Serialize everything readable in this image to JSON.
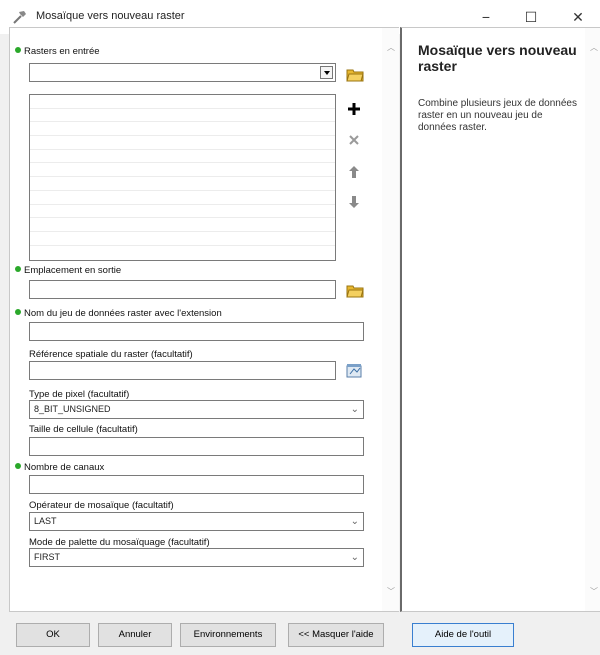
{
  "window": {
    "title": "Mosaïque vers nouveau raster",
    "minimize": "−",
    "maximize": "☐",
    "close": "✕"
  },
  "params": {
    "input_rasters": {
      "label": "Rasters en entrée",
      "value": ""
    },
    "output_location": {
      "label": "Emplacement en sortie",
      "value": ""
    },
    "dataset_name": {
      "label": "Nom du jeu de données raster avec l'extension",
      "value": ""
    },
    "spatial_reference": {
      "label": "Référence spatiale du raster (facultatif)",
      "value": ""
    },
    "pixel_type": {
      "label": "Type de pixel (facultatif)",
      "value": "8_BIT_UNSIGNED"
    },
    "cell_size": {
      "label": "Taille de cellule (facultatif)",
      "value": ""
    },
    "band_count": {
      "label": "Nombre de canaux",
      "value": ""
    },
    "mosaic_operator": {
      "label": "Opérateur de mosaïque (facultatif)",
      "value": "LAST"
    },
    "colormap_mode": {
      "label": "Mode de palette du mosaïquage (facultatif)",
      "value": "FIRST"
    }
  },
  "help": {
    "title": "Mosaïque vers nouveau raster",
    "text": "Combine plusieurs jeux de données raster en un nouveau jeu de données raster."
  },
  "buttons": {
    "ok": "OK",
    "cancel": "Annuler",
    "environments": "Environnements",
    "hide_help": "<< Masquer l'aide",
    "tool_help": "Aide de l'outil"
  },
  "colors": {
    "required_dot": "#2aa82a",
    "folder_icon": "#e8b830",
    "focus_border": "#3a7fd0"
  }
}
